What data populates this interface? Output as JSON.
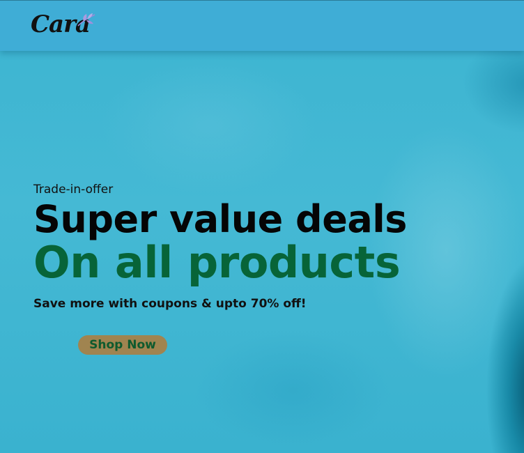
{
  "header": {
    "brand": "Cara"
  },
  "hero": {
    "eyebrow": "Trade-in-offer",
    "headline": "Super value deals",
    "subheadline": "On all products",
    "tagline": "Save more with coupons & upto 70% off!",
    "cta_label": "Shop Now"
  },
  "colors": {
    "header_bg": "#3fadd6",
    "hero_bg": "#3fb6d3",
    "headline": "#050505",
    "subheadline": "#076438",
    "cta_bg": "#a08450",
    "cta_text": "#0e5a2e"
  }
}
